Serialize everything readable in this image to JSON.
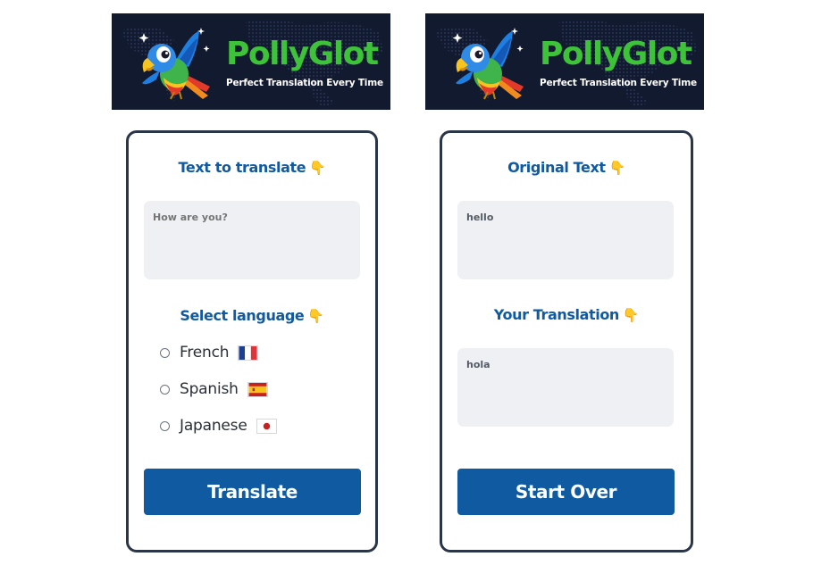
{
  "brand": {
    "name": "PollyGlot",
    "tagline": "Perfect Translation Every Time"
  },
  "translate_card": {
    "heading": "Text to translate",
    "heading_emoji": "👇",
    "input": {
      "value": "",
      "placeholder": "How are you?"
    },
    "language_heading": "Select language",
    "language_emoji": "👇",
    "languages": [
      {
        "label": "French",
        "flag": "france-flag-icon"
      },
      {
        "label": "Spanish",
        "flag": "spain-flag-icon"
      },
      {
        "label": "Japanese",
        "flag": "japan-flag-icon"
      }
    ],
    "button_label": "Translate"
  },
  "result_card": {
    "original_heading": "Original Text",
    "original_emoji": "👇",
    "original_text": "hello",
    "translation_heading": "Your Translation",
    "translation_emoji": "👇",
    "translation_text": "hola",
    "button_label": "Start Over"
  },
  "colors": {
    "accent": "#0f5aa0",
    "brand_green": "#3ec23a",
    "banner_bg": "#121a30",
    "card_border": "#2a3547",
    "field_bg": "#eef0f3"
  }
}
